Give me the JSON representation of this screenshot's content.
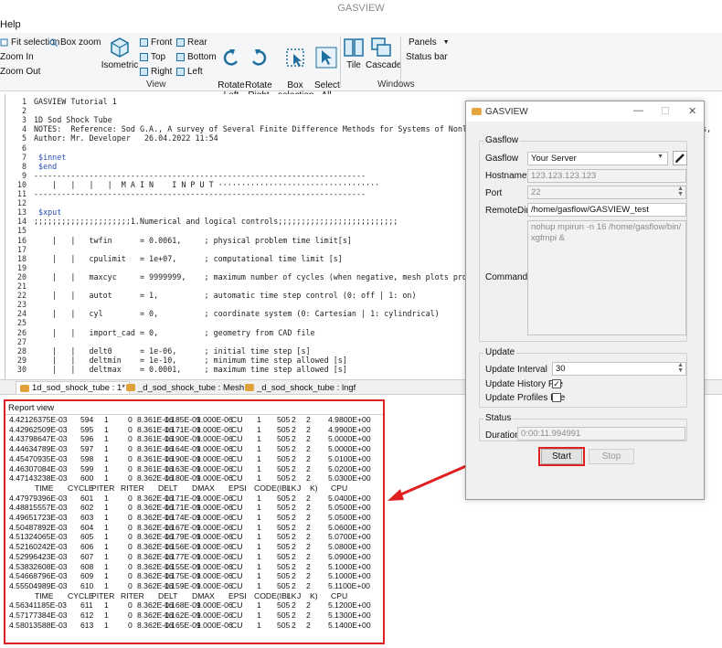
{
  "window": {
    "title": "GASVIEW"
  },
  "menu": {
    "help": "Help"
  },
  "ribbon": {
    "view_small": [
      "Fit selection",
      "Box zoom",
      "Zoom In",
      "Zoom Out"
    ],
    "isometric": "Isometric",
    "views": [
      "Front",
      "Rear",
      "Top",
      "Bottom",
      "Right",
      "Left"
    ],
    "rotate_left": "Rotate\nLeft",
    "rotate_right": "Rotate\nRight",
    "box_selection": "Box\nselection",
    "select_all": "Select\nAll",
    "tile": "Tile",
    "cascade": "Cascade",
    "panels": "Panels",
    "status_bar": "Status bar",
    "group_view": "View",
    "group_windows": "Windows"
  },
  "editor": {
    "lines": [
      {
        "n": "1",
        "t": "GASVIEW Tutorial 1"
      },
      {
        "n": "2",
        "t": ""
      },
      {
        "n": "3",
        "t": "1D Sod Shock Tube"
      },
      {
        "n": "4",
        "t": "NOTES:  Reference: Sod G.A., A survey of Several Finite Difference Methods for Systems of Nonlinear Hyperbolic Conservation Laws, J. Comp. Physics,"
      },
      {
        "n": "5",
        "t": "Author: Mr. Developer   26.04.2022 11:54"
      },
      {
        "n": "6",
        "t": ""
      },
      {
        "n": "7",
        "t": " $innet"
      },
      {
        "n": "8",
        "t": " $end"
      },
      {
        "n": "9",
        "t": "------------------------------------------------------------------------"
      },
      {
        "n": "10",
        "t": "    |   |   |   |  M A I N    I N P U T ···································"
      },
      {
        "n": "11",
        "t": "------------------------------------------------------------------------"
      },
      {
        "n": "12",
        "t": ""
      },
      {
        "n": "13",
        "t": " $xput"
      },
      {
        "n": "14",
        "t": ";;;;;;;;;;;;;;;;;;;;;1.Numerical and logical controls;;;;;;;;;;;;;;;;;;;;;;;;;;"
      },
      {
        "n": "15",
        "t": ""
      },
      {
        "n": "16",
        "t": "    |   |   twfin      = 0.0061,     ; physical problem time limit[s]"
      },
      {
        "n": "17",
        "t": ""
      },
      {
        "n": "18",
        "t": "    |   |   cpulimit   = 1e+07,      ; computational time limit [s]"
      },
      {
        "n": "19",
        "t": ""
      },
      {
        "n": "20",
        "t": "    |   |   maxcyc     = 9999999,    ; maximum number of cycles (when negative, mesh plots produced)"
      },
      {
        "n": "21",
        "t": ""
      },
      {
        "n": "22",
        "t": "    |   |   autot      = 1,          ; automatic time step control (0: off | 1: on)"
      },
      {
        "n": "23",
        "t": ""
      },
      {
        "n": "24",
        "t": "    |   |   cyl        = 0,          ; coordinate system (0: Cartesian | 1: cylindrical)"
      },
      {
        "n": "25",
        "t": ""
      },
      {
        "n": "26",
        "t": "    |   |   import_cad = 0,          ; geometry from CAD file"
      },
      {
        "n": "27",
        "t": ""
      },
      {
        "n": "28",
        "t": "    |   |   delt0      = 1e-06,      ; initial time step [s]"
      },
      {
        "n": "29",
        "t": "    |   |   deltmin    = 1e-10,      ; minimum time step allowed [s]"
      },
      {
        "n": "30",
        "t": "    |   |   deltmax    = 0.0001,     ; maximum time step allowed [s]"
      }
    ]
  },
  "tabs": [
    "1d_sod_shock_tube : 1*",
    "_d_sod_shock_tube : Mesh",
    "_d_sod_shock_tube : lngf"
  ],
  "report": {
    "title": "Report view",
    "header": [
      "TIME",
      "CYCLE",
      "PITER",
      "RITER",
      "DELT",
      "DMAX",
      "EPSI",
      "CODE(IBLK",
      "I",
      "J",
      "K)",
      "CPU"
    ],
    "rows_a": [
      [
        "4.42126375E-03",
        "594",
        "1",
        "0",
        "8.361E-06",
        "1.185E-09",
        "1.000E-06",
        "CU",
        "1",
        "505",
        "2",
        "2",
        "4.9800E+00"
      ],
      [
        "4.42962509E-03",
        "595",
        "1",
        "0",
        "8.361E-06",
        "1.171E-09",
        "1.000E-06",
        "CU",
        "1",
        "505",
        "2",
        "2",
        "4.9900E+00"
      ],
      [
        "4.43798647E-03",
        "596",
        "1",
        "0",
        "8.361E-06",
        "1.190E-09",
        "1.000E-06",
        "CU",
        "1",
        "505",
        "2",
        "2",
        "5.0000E+00"
      ],
      [
        "4.44634789E-03",
        "597",
        "1",
        "0",
        "8.361E-06",
        "1.164E-09",
        "1.000E-06",
        "CU",
        "1",
        "505",
        "2",
        "2",
        "5.0000E+00"
      ],
      [
        "4.45470935E-03",
        "598",
        "1",
        "0",
        "8.361E-06",
        "1.190E-09",
        "1.000E-06",
        "CU",
        "1",
        "505",
        "2",
        "2",
        "5.0100E+00"
      ],
      [
        "4.46307084E-03",
        "599",
        "1",
        "0",
        "8.361E-06",
        "1.163E-09",
        "1.000E-06",
        "CU",
        "1",
        "505",
        "2",
        "2",
        "5.0200E+00"
      ],
      [
        "4.47143238E-03",
        "600",
        "1",
        "0",
        "8.362E-06",
        "1.180E-09",
        "1.000E-06",
        "CU",
        "1",
        "505",
        "2",
        "2",
        "5.0300E+00"
      ]
    ],
    "rows_b": [
      [
        "4.47979396E-03",
        "601",
        "1",
        "0",
        "8.362E-06",
        "1.171E-09",
        "1.000E-06",
        "CU",
        "1",
        "505",
        "2",
        "2",
        "5.0400E+00"
      ],
      [
        "4.48815557E-03",
        "602",
        "1",
        "0",
        "8.362E-06",
        "1.171E-09",
        "1.000E-06",
        "CU",
        "1",
        "505",
        "2",
        "2",
        "5.0500E+00"
      ],
      [
        "4.49651723E-03",
        "603",
        "1",
        "0",
        "8.362E-06",
        "1.174E-09",
        "1.000E-06",
        "CU",
        "1",
        "505",
        "2",
        "2",
        "5.0500E+00"
      ],
      [
        "4.50487892E-03",
        "604",
        "1",
        "0",
        "8.362E-06",
        "1.167E-09",
        "1.000E-06",
        "CU",
        "1",
        "505",
        "2",
        "2",
        "5.0600E+00"
      ],
      [
        "4.51324065E-03",
        "605",
        "1",
        "0",
        "8.362E-06",
        "1.179E-09",
        "1.000E-06",
        "CU",
        "1",
        "505",
        "2",
        "2",
        "5.0700E+00"
      ],
      [
        "4.52160242E-03",
        "606",
        "1",
        "0",
        "8.362E-06",
        "1.156E-09",
        "1.000E-06",
        "CU",
        "1",
        "505",
        "2",
        "2",
        "5.0800E+00"
      ],
      [
        "4.52996423E-03",
        "607",
        "1",
        "0",
        "8.362E-06",
        "1.177E-09",
        "1.000E-06",
        "CU",
        "1",
        "505",
        "2",
        "2",
        "5.0900E+00"
      ],
      [
        "4.53832608E-03",
        "608",
        "1",
        "0",
        "8.362E-06",
        "1.155E-09",
        "1.000E-06",
        "CU",
        "1",
        "505",
        "2",
        "2",
        "5.1000E+00"
      ],
      [
        "4.54668796E-03",
        "609",
        "1",
        "0",
        "8.362E-06",
        "1.175E-09",
        "1.000E-06",
        "CU",
        "1",
        "505",
        "2",
        "2",
        "5.1000E+00"
      ],
      [
        "4.55504989E-03",
        "610",
        "1",
        "0",
        "8.362E-06",
        "1.159E-09",
        "1.000E-06",
        "CU",
        "1",
        "505",
        "2",
        "2",
        "5.1100E+00"
      ]
    ],
    "rows_c": [
      [
        "4.56341185E-03",
        "611",
        "1",
        "0",
        "8.362E-06",
        "1.168E-09",
        "1.000E-06",
        "CU",
        "1",
        "505",
        "2",
        "2",
        "5.1200E+00"
      ],
      [
        "4.57177384E-03",
        "612",
        "1",
        "0",
        "8.362E-06",
        "1.162E-09",
        "1.000E-06",
        "CU",
        "1",
        "505",
        "2",
        "2",
        "5.1300E+00"
      ],
      [
        "4.58013588E-03",
        "613",
        "1",
        "0",
        "8.362E-06",
        "1.165E-09",
        "1.000E-06",
        "CU",
        "1",
        "505",
        "2",
        "2",
        "5.1400E+00"
      ]
    ]
  },
  "dialog": {
    "title": "GASVIEW",
    "gasflow_group": "Gasflow",
    "gasflow_label": "Gasflow",
    "gasflow_value": "Your Server",
    "hostname_label": "Hostname",
    "hostname_value": "123.123.123.123",
    "port_label": "Port",
    "port_value": "22",
    "remotedir_label": "RemoteDir",
    "remotedir_value": "/home/gasflow/GASVIEW_test",
    "commands_label": "Commands",
    "commands_value": "nohup mpirun -n 16 /home/gasflow/bin/\nxgfmpi &",
    "update_group": "Update",
    "update_interval_label": "Update Interval",
    "update_interval_value": "30",
    "update_history_label": "Update History File",
    "update_history_checked": "✓",
    "update_profiles_label": "Update Profiles File",
    "status_group": "Status",
    "duration_label": "Duration",
    "duration_value": "0:00:11.994991",
    "start": "Start",
    "stop": "Stop"
  },
  "colors": {
    "highlight": "#e02020",
    "keyword": "#2b4fb5",
    "accent": "#e3a53d"
  }
}
